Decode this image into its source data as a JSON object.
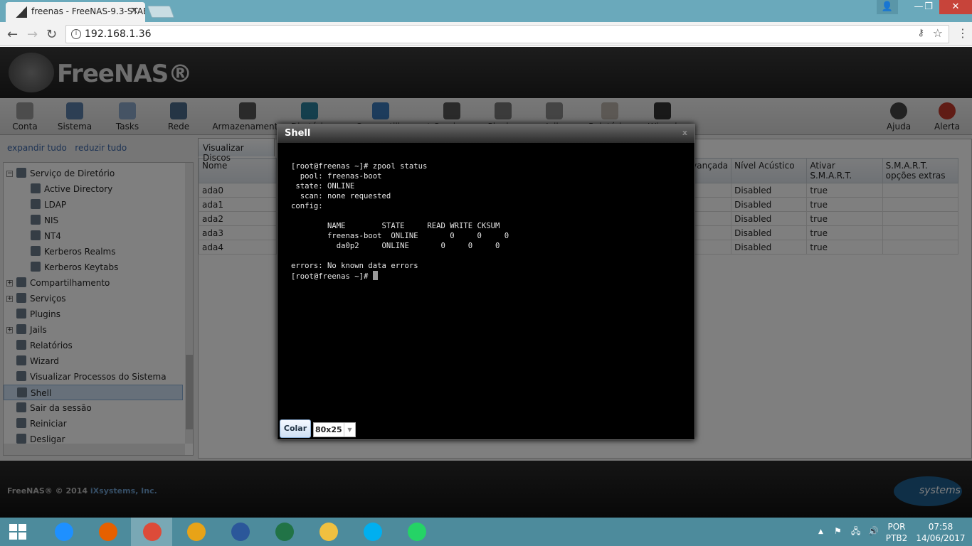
{
  "browser": {
    "tab_title": "freenas - FreeNAS-9.3-STABLE",
    "url": "192.168.1.36",
    "win_user": "👤",
    "min": "—",
    "max": "❐",
    "close": "✕"
  },
  "app": {
    "logo": "FreeNAS®"
  },
  "toolbar": [
    "Conta",
    "Sistema",
    "Tasks",
    "Rede",
    "Armazenamento",
    "Diretório",
    "Compartilhamentos",
    "Serviços",
    "Plugins",
    "Jails",
    "Relatórios",
    "Wizard"
  ],
  "toolbar_right": [
    "Ajuda",
    "Alerta"
  ],
  "left": {
    "expand": "expandir tudo",
    "collapse": "reduzir tudo",
    "tree": [
      {
        "label": "Serviço de Diretório",
        "level": 0,
        "exp": "−"
      },
      {
        "label": "Active Directory",
        "level": 1
      },
      {
        "label": "LDAP",
        "level": 1
      },
      {
        "label": "NIS",
        "level": 1
      },
      {
        "label": "NT4",
        "level": 1
      },
      {
        "label": "Kerberos Realms",
        "level": 1
      },
      {
        "label": "Kerberos Keytabs",
        "level": 1
      },
      {
        "label": "Compartilhamento",
        "level": 0,
        "exp": "+"
      },
      {
        "label": "Serviços",
        "level": 0,
        "exp": "+"
      },
      {
        "label": "Plugins",
        "level": 0
      },
      {
        "label": "Jails",
        "level": 0,
        "exp": "+"
      },
      {
        "label": "Relatórios",
        "level": 0
      },
      {
        "label": "Wizard",
        "level": 0
      },
      {
        "label": "Visualizar Processos do Sistema",
        "level": 0
      },
      {
        "label": "Shell",
        "level": 0,
        "selected": true
      },
      {
        "label": "Sair da sessão",
        "level": 0
      },
      {
        "label": "Reiniciar",
        "level": 0
      },
      {
        "label": "Desligar",
        "level": 0
      }
    ]
  },
  "main": {
    "tab": "Visualizar Discos",
    "columns": [
      "Nome",
      "Avançada",
      "Nível Acústico",
      "Ativar S.M.A.R.T.",
      "S.M.A.R.T. opções extras"
    ],
    "rows": [
      [
        "ada0",
        "",
        "Disabled",
        "true",
        ""
      ],
      [
        "ada1",
        "",
        "Disabled",
        "true",
        ""
      ],
      [
        "ada2",
        "",
        "Disabled",
        "true",
        ""
      ],
      [
        "ada3",
        "",
        "Disabled",
        "true",
        ""
      ],
      [
        "ada4",
        "",
        "Disabled",
        "true",
        ""
      ]
    ]
  },
  "footer": {
    "copyright": "FreeNAS® © 2014 ",
    "company": "iXsystems, Inc.",
    "ix_logo": "systems"
  },
  "shell": {
    "title": "Shell",
    "close": "x",
    "lines": [
      "[root@freenas ~]# zpool status",
      "  pool: freenas-boot",
      " state: ONLINE",
      "  scan: none requested",
      "config:",
      "",
      "        NAME        STATE     READ WRITE CKSUM",
      "        freenas-boot  ONLINE       0     0     0",
      "          da0p2     ONLINE       0     0     0",
      "",
      "errors: No known data errors"
    ],
    "prompt": "[root@freenas ~]# ",
    "paste": "Colar",
    "size": "80x25"
  },
  "taskbar": {
    "apps": [
      "Internet Explorer",
      "Firefox",
      "Chrome",
      "Outlook",
      "Word",
      "Excel",
      "File Explorer",
      "Skype",
      "WhatsApp"
    ],
    "lang1": "POR",
    "lang2": "PTB2",
    "time": "07:58",
    "date": "14/06/2017"
  }
}
